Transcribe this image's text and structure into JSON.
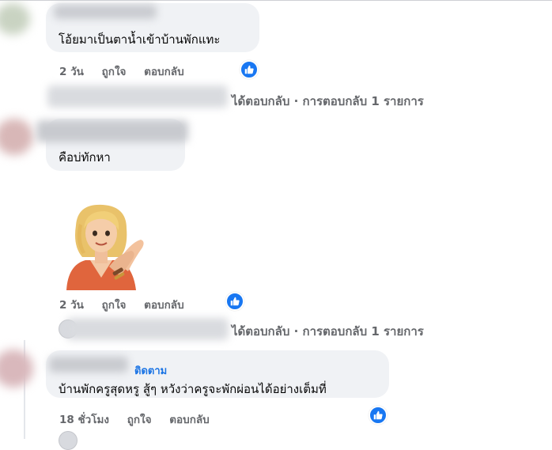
{
  "comments": [
    {
      "text": "โอ้ยมาเป็นตาน้ำเข้าบ้านพักแทะ",
      "time": "2 วัน",
      "like": "ถูกใจ",
      "reply": "ตอบกลับ",
      "replies_summary": "ได้ตอบกลับ · การตอบกลับ 1 รายการ"
    },
    {
      "text": "คือบ่ทักหา",
      "time": "2 วัน",
      "like": "ถูกใจ",
      "reply": "ตอบกลับ",
      "replies_summary": "ได้ตอบกลับ · การตอบกลับ 1 รายการ"
    },
    {
      "follow": "ติดตาม",
      "text": "บ้านพักครูสุดหรู สู้ๆ หวังว่าครูจะพักผ่อนได้อย่างเต็มที่",
      "time": "18 ชั่วโมง",
      "like": "ถูกใจ",
      "reply": "ตอบกลับ"
    }
  ],
  "icons": {
    "reaction": "like-thumb-icon",
    "sticker": "waving-woman-sticker"
  },
  "colors": {
    "like_blue": "#1877f2",
    "bubble_bg": "#f0f2f5",
    "meta_text": "#65676b",
    "link_blue": "#1b74e4"
  }
}
